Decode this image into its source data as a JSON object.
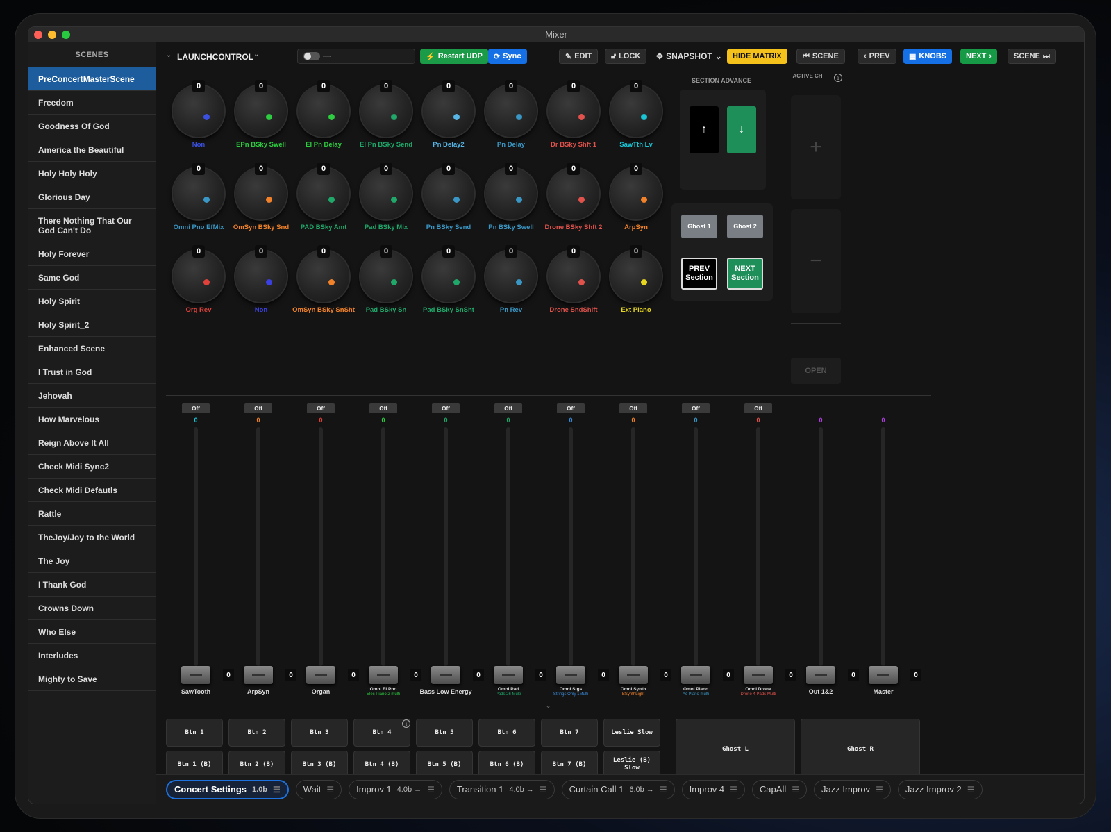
{
  "window": {
    "title": "Mixer"
  },
  "sidebar": {
    "header": "SCENES",
    "items": [
      "PreConcertMasterScene",
      "Freedom",
      "Goodness Of God",
      "America the Beautiful",
      "Holy Holy Holy",
      "Glorious Day",
      "There Nothing That Our God Can't Do",
      "Holy Forever",
      "Same God",
      "Holy Spirit",
      "Holy Spirit_2",
      "Enhanced Scene",
      "I Trust in God",
      "Jehovah",
      "How Marvelous",
      "Reign Above It All",
      "Check Midi Sync2",
      "Check Midi Defautls",
      "Rattle",
      "TheJoy/Joy to  the  World",
      "The Joy",
      "I Thank God",
      "Crowns Down",
      "Who Else",
      "Interludes",
      "Mighty to Save"
    ],
    "active_index": 0
  },
  "toolbar": {
    "controller": "LAUNCHCONTROL",
    "toggle_text": "----",
    "restart": "Restart UDP",
    "sync": "Sync",
    "edit": "EDIT",
    "lock": "LOCK",
    "snapshot": "SNAPSHOT",
    "hide_matrix": "HIDE MATRIX",
    "scene_prev": "SCENE",
    "prev": "PREV",
    "knobs": "KNOBS",
    "next": "NEXT",
    "scene_next": "SCENE"
  },
  "knobs": [
    {
      "label": "Non",
      "value": "0",
      "color": "#3b50e0"
    },
    {
      "label": "EPn BSky Swell",
      "value": "0",
      "color": "#2ecc40"
    },
    {
      "label": "El Pn Delay",
      "value": "0",
      "color": "#2ecc40"
    },
    {
      "label": "El Pn BSky Send",
      "value": "0",
      "color": "#1fa86a"
    },
    {
      "label": "Pn Delay2",
      "value": "0",
      "color": "#57b5e6"
    },
    {
      "label": "Pn Delay",
      "value": "0",
      "color": "#3a96c4"
    },
    {
      "label": "Dr BSky Shft 1",
      "value": "0",
      "color": "#e0524b"
    },
    {
      "label": "SawTth Lv",
      "value": "0",
      "color": "#19c6d6"
    },
    {
      "label": "Omni Pno EfMix",
      "value": "0",
      "color": "#3a96c4"
    },
    {
      "label": "OmSyn BSky Snd",
      "value": "0",
      "color": "#f2822a"
    },
    {
      "label": "PAD BSky Amt",
      "value": "0",
      "color": "#1fa86a"
    },
    {
      "label": "Pad BSky Mix",
      "value": "0",
      "color": "#1fa86a"
    },
    {
      "label": "Pn BSky Send",
      "value": "0",
      "color": "#3a96c4"
    },
    {
      "label": "Pn BSky Swell",
      "value": "0",
      "color": "#3a96c4"
    },
    {
      "label": "Drone BSky Shft 2",
      "value": "0",
      "color": "#e0524b"
    },
    {
      "label": "ArpSyn",
      "value": "0",
      "color": "#f2822a"
    },
    {
      "label": "Org Rev",
      "value": "0",
      "color": "#e0423b"
    },
    {
      "label": "Non",
      "value": "0",
      "color": "#3b40e0"
    },
    {
      "label": "OmSyn BSky SnSht",
      "value": "0",
      "color": "#f2822a"
    },
    {
      "label": "Pad BSky Sn",
      "value": "0",
      "color": "#1fa86a"
    },
    {
      "label": "Pad BSky SnSht",
      "value": "0",
      "color": "#1fa86a"
    },
    {
      "label": "Pn Rev",
      "value": "0",
      "color": "#3a96c4"
    },
    {
      "label": "Drone SndShift",
      "value": "0",
      "color": "#e0524b"
    },
    {
      "label": "Ext Piano",
      "value": "0",
      "color": "#e6d620"
    }
  ],
  "section": {
    "title": "SECTION ADVANCE",
    "ghost1": "Ghost 1",
    "ghost2": "Ghost 2",
    "prev_section": "PREV Section",
    "next_section": "NEXT Section",
    "active_ch": "ACTIVE CH",
    "plus": "+",
    "minus": "−",
    "open": "OPEN"
  },
  "faders": [
    {
      "name": "SawTooth",
      "sub": "",
      "value": "0",
      "num": "0",
      "off": "Off",
      "color": "#19c6d6",
      "sub_color": ""
    },
    {
      "name": "ArpSyn",
      "sub": "",
      "value": "0",
      "num": "0",
      "off": "Off",
      "color": "#f2822a",
      "sub_color": ""
    },
    {
      "name": "Organ",
      "sub": "",
      "value": "0",
      "num": "0",
      "off": "Off",
      "color": "#e0423b",
      "sub_color": ""
    },
    {
      "name": "Omni El Pno",
      "sub": "Elec Piano 2 multi",
      "value": "0",
      "num": "0",
      "off": "Off",
      "color": "#2ecc40",
      "sub_color": "#2ecc40"
    },
    {
      "name": "Bass Low Energy",
      "sub": "",
      "value": "0",
      "num": "0",
      "off": "Off",
      "color": "#1fa86a",
      "sub_color": ""
    },
    {
      "name": "Omni Pad",
      "sub": "Pads 26 Multi",
      "value": "0",
      "num": "0",
      "off": "Off",
      "color": "#1fa86a",
      "sub_color": "#1fa86a"
    },
    {
      "name": "Omni Stgs",
      "sub": "Strings Only 1Multi",
      "value": "0",
      "num": "0",
      "off": "Off",
      "color": "#3a8ad8",
      "sub_color": "#3a8ad8"
    },
    {
      "name": "Omni Synth",
      "sub": "BSynthLight",
      "value": "0",
      "num": "0",
      "off": "Off",
      "color": "#f2822a",
      "sub_color": "#f2822a"
    },
    {
      "name": "Omni Piano",
      "sub": "Ac Piano multi",
      "value": "0",
      "num": "0",
      "off": "Off",
      "color": "#3a96c4",
      "sub_color": "#3a96c4"
    },
    {
      "name": "Omni Drone",
      "sub": "Drone 4 Pads Multi",
      "value": "0",
      "num": "0",
      "off": "Off",
      "color": "#e0524b",
      "sub_color": "#e0524b"
    },
    {
      "name": "Out 1&2",
      "sub": "",
      "value": "0",
      "num": "0",
      "off": "",
      "color": "#b040e0",
      "sub_color": ""
    },
    {
      "name": "Master",
      "sub": "",
      "value": "0",
      "num": "0",
      "off": "",
      "color": "#b040e0",
      "sub_color": ""
    }
  ],
  "buttons_top": [
    "Btn 1",
    "Btn 2",
    "Btn 3",
    "Btn 4",
    "Btn 5",
    "Btn 6",
    "Btn 7",
    "Leslie Slow"
  ],
  "buttons_bottom": [
    "Btn 1 (B)",
    "Btn 2 (B)",
    "Btn 3 (B)",
    "Btn 4 (B)",
    "Btn 5 (B)",
    "Btn 6 (B)",
    "Btn 7 (B)",
    "Leslie (B) Slow"
  ],
  "ghost_l": "Ghost L",
  "ghost_r": "Ghost R",
  "sections": [
    {
      "name": "Concert Settings",
      "dur": "1.0b",
      "active": true
    },
    {
      "name": "Wait",
      "dur": ""
    },
    {
      "name": "Improv 1",
      "dur": "4.0b →"
    },
    {
      "name": "Transition 1",
      "dur": "4.0b →"
    },
    {
      "name": "Curtain Call 1",
      "dur": "6.0b →"
    },
    {
      "name": "Improv 4",
      "dur": ""
    },
    {
      "name": "CapAll",
      "dur": ""
    },
    {
      "name": "Jazz Improv",
      "dur": ""
    },
    {
      "name": "Jazz Improv 2",
      "dur": ""
    }
  ],
  "colors": {
    "accent": "#1d72e0",
    "active_scene": "#1d5d9e",
    "next_green": "#179a45"
  }
}
